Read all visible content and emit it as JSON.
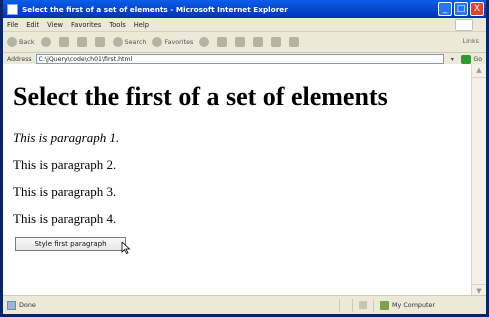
{
  "window": {
    "title": "Select the first of a set of elements - Microsoft Internet Explorer",
    "controls": [
      "_",
      "□",
      "X"
    ]
  },
  "menubar": [
    "File",
    "Edit",
    "View",
    "Favorites",
    "Tools",
    "Help"
  ],
  "toolbar": {
    "back": "Back",
    "search": "Search",
    "favorites": "Favorites",
    "links": "Links"
  },
  "addressbar": {
    "label": "Address",
    "value": "C:\\jQuery\\code\\ch01\\first.html",
    "go_label": "Go"
  },
  "page": {
    "heading": "Select the first of a set of elements",
    "paragraphs": [
      "This is paragraph 1.",
      "This is paragraph 2.",
      "This is paragraph 3.",
      "This is paragraph 4."
    ],
    "button_label": "Style first paragraph"
  },
  "statusbar": {
    "status": "Done",
    "zone": "My Computer"
  }
}
